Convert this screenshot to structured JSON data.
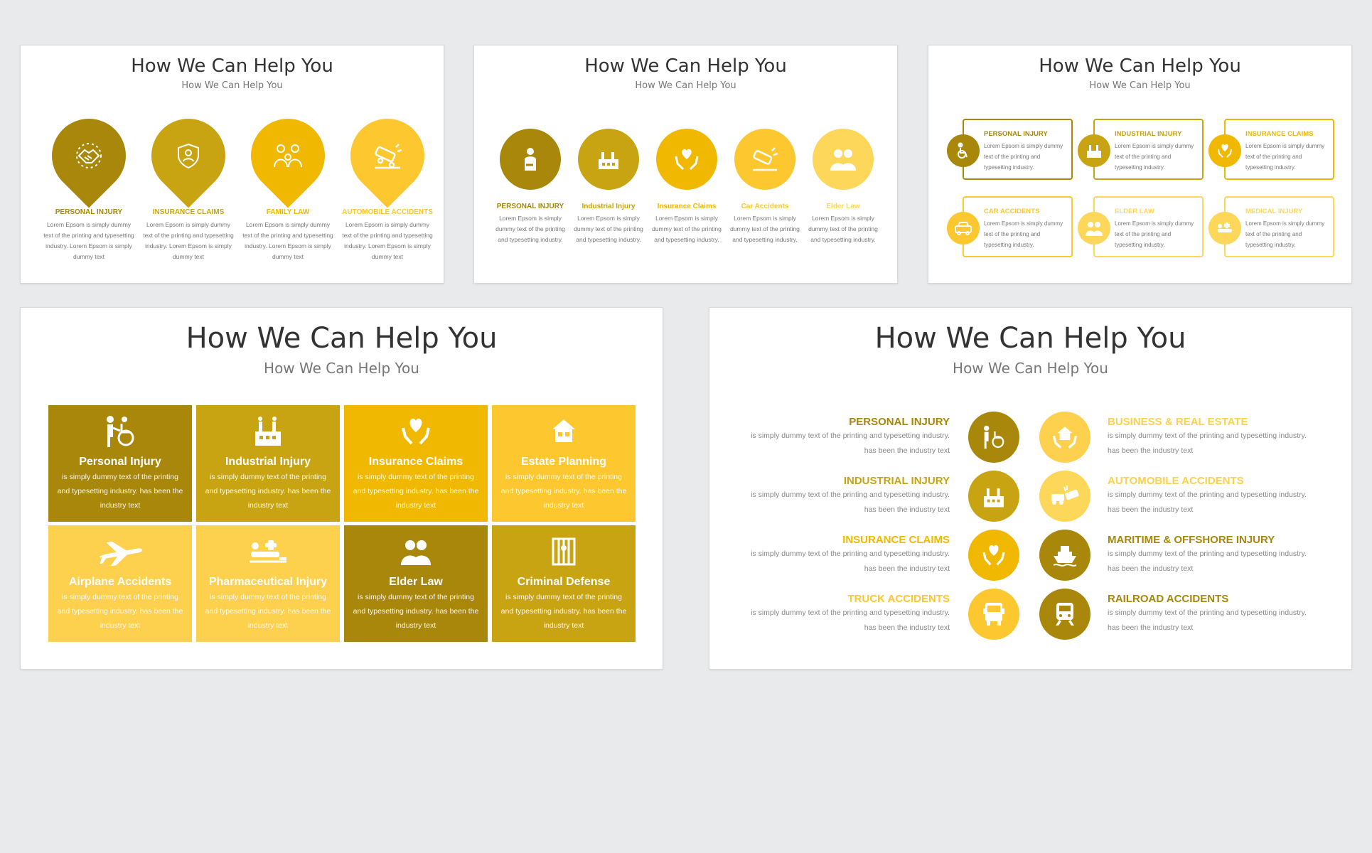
{
  "colors": {
    "dark": "#a8870b",
    "mid": "#c8a412",
    "gold": "#f0b800",
    "light": "#fcc72f",
    "pale": "#fdd75a",
    "text_gray": "#777777",
    "background": "#e9eaec"
  },
  "slide1": {
    "title": "How We Can Help You",
    "subtitle": "How We Can Help You",
    "items": [
      {
        "label": "PERSONAL INJURY",
        "text": "Lorem Epsom is simply dummy text of the printing and typesetting industry. Lorem Epsom is simply dummy text",
        "icon": "handshake-icon"
      },
      {
        "label": "INSURANCE CLAIMS",
        "text": "Lorem Epsom is simply dummy text of the printing and typesetting industry. Lorem Epsom is simply dummy text",
        "icon": "shield-person-icon"
      },
      {
        "label": "FAMILY LAW",
        "text": "Lorem Epsom is simply dummy text of the printing and typesetting industry. Lorem Epsom is simply dummy text",
        "icon": "family-icon"
      },
      {
        "label": "AUTOMOBILE ACCIDENTS",
        "text": "Lorem Epsom is simply dummy text of the printing and typesetting industry. Lorem Epsom is simply dummy text",
        "icon": "car-crash-icon"
      }
    ]
  },
  "slide2": {
    "title": "How We Can Help You",
    "subtitle": "How We Can Help You",
    "items": [
      {
        "label": "PERSONAL INJURY",
        "text": "Lorem Epsom is simply dummy text of the printing and typesetting industry.",
        "icon": "injured-person-icon"
      },
      {
        "label": "Industrial Injury",
        "text": "Lorem Epsom is simply dummy text of the printing and typesetting industry.",
        "icon": "factory-icon"
      },
      {
        "label": "Insurance Claims",
        "text": "Lorem Epsom is simply dummy text of the printing and typesetting industry.",
        "icon": "heart-hands-icon"
      },
      {
        "label": "Car Accidents",
        "text": "Lorem Epsom is simply dummy text of the printing and typesetting industry.",
        "icon": "car-crash-icon"
      },
      {
        "label": "Elder Law",
        "text": "Lorem Epsom is simply dummy text of the printing and typesetting industry.",
        "icon": "elderly-couple-icon"
      }
    ]
  },
  "slide3": {
    "title": "How We Can Help You",
    "subtitle": "How We Can Help You",
    "items": [
      {
        "label": "PERSONAL INJURY",
        "text": "Lorem Epsom is simply dummy text of the printing and typesetting industry.",
        "icon": "wheelchair-icon"
      },
      {
        "label": "INDUSTRIAL INJURY",
        "text": "Lorem Epsom is simply dummy text of the printing and typesetting industry.",
        "icon": "factory-icon"
      },
      {
        "label": "INSURANCE CLAIMS",
        "text": "Lorem Epsom is simply dummy text of the printing and typesetting industry.",
        "icon": "heart-hands-icon"
      },
      {
        "label": "CAR ACCIDENTS",
        "text": "Lorem Epsom is simply dummy text of the printing and typesetting industry.",
        "icon": "car-crash-icon"
      },
      {
        "label": "ELDER LAW",
        "text": "Lorem Epsom is simply dummy text of the printing and typesetting industry.",
        "icon": "elderly-couple-icon"
      },
      {
        "label": "MEDICAL INJURY",
        "text": "Lorem Epsom is simply dummy text of the printing and typesetting industry.",
        "icon": "medical-injury-icon"
      }
    ]
  },
  "slide4": {
    "title": "How We Can Help You",
    "subtitle": "How We Can Help You",
    "tiles": [
      {
        "label": "Personal Injury",
        "text": "is simply dummy text of the printing and typesetting industry. has been the industry text",
        "icon": "wheelchair-icon"
      },
      {
        "label": "Industrial Injury",
        "text": "is simply dummy text of the printing and typesetting industry. has been the industry text",
        "icon": "factory-icon"
      },
      {
        "label": "Insurance Claims",
        "text": "is simply dummy text of the printing and typesetting industry. has been the industry text",
        "icon": "heart-hands-icon"
      },
      {
        "label": "Estate Planning",
        "text": "is simply dummy text of the printing and typesetting industry. has been the industry text",
        "icon": "house-icon"
      },
      {
        "label": "Airplane Accidents",
        "text": "is simply dummy text of the printing and typesetting industry. has been the industry text",
        "icon": "airplane-icon"
      },
      {
        "label": "Pharmaceutical Injury",
        "text": "is simply dummy text of the printing and typesetting industry. has been the industry text",
        "icon": "pharmaceutical-icon"
      },
      {
        "label": "Elder Law",
        "text": "is simply dummy text of the printing and typesetting industry. has been the industry text",
        "icon": "elderly-couple-icon"
      },
      {
        "label": "Criminal Defense",
        "text": "is simply dummy text of the printing and typesetting industry. has been the industry text",
        "icon": "prison-icon"
      }
    ]
  },
  "slide5": {
    "title": "How We Can Help You",
    "subtitle": "How We Can Help You",
    "left": [
      {
        "label": "PERSONAL INJURY",
        "text1": "is simply dummy text of the printing and typesetting industry.",
        "text2": "has been the industry text",
        "icon": "wheelchair-icon"
      },
      {
        "label": "INDUSTRIAL INJURY",
        "text1": "is simply dummy text of the printing and typesetting industry.",
        "text2": "has been the industry text",
        "icon": "factory-icon"
      },
      {
        "label": "INSURANCE CLAIMS",
        "text1": "is simply dummy text of the printing and typesetting industry.",
        "text2": "has been the industry text",
        "icon": "heart-hands-icon"
      },
      {
        "label": "TRUCK ACCIDENTS",
        "text1": "is simply dummy text of the printing and typesetting industry.",
        "text2": "has been the industry text",
        "icon": "truck-icon"
      }
    ],
    "right": [
      {
        "label": "BUSINESS & REAL ESTATE",
        "text1": "is simply dummy text of the printing and typesetting industry.",
        "text2": "has been the industry text",
        "icon": "house-hands-icon"
      },
      {
        "label": "AUTOMOBILE ACCIDENTS",
        "text1": "is simply dummy text of the printing and typesetting industry.",
        "text2": "has been the industry text",
        "icon": "car-crash-icon"
      },
      {
        "label": "MARITIME & OFFSHORE INJURY",
        "text1": "is simply dummy text of the printing and typesetting industry.",
        "text2": "has been the industry text",
        "icon": "ship-icon"
      },
      {
        "label": "RAILROAD ACCIDENTS",
        "text1": "is simply dummy text of the printing and typesetting industry.",
        "text2": "has been the industry text",
        "icon": "train-icon"
      }
    ]
  }
}
